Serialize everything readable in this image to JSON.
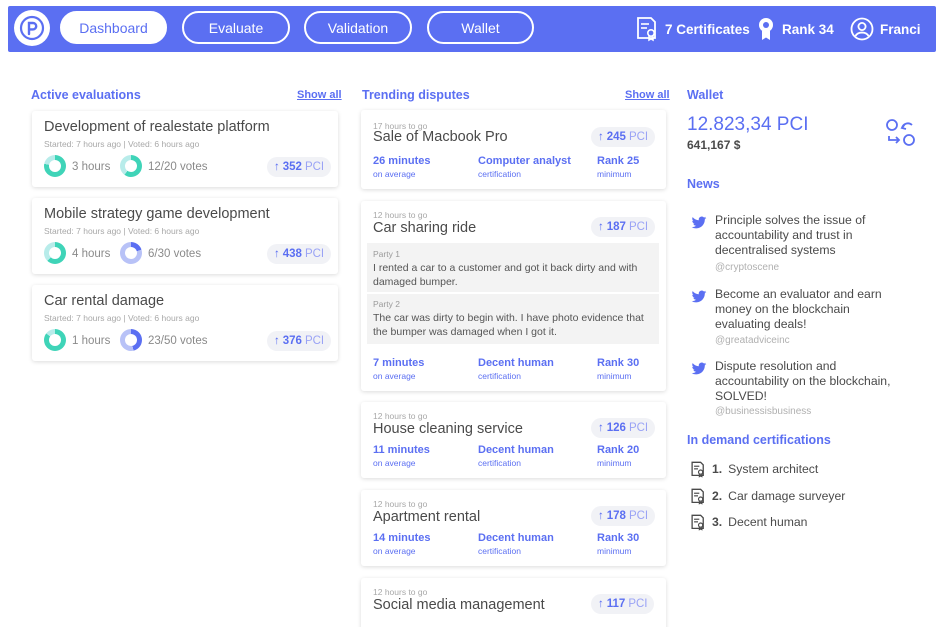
{
  "header": {
    "nav": [
      {
        "label": "Dashboard",
        "active": true
      },
      {
        "label": "Evaluate",
        "active": false
      },
      {
        "label": "Validation",
        "active": false
      },
      {
        "label": "Wallet",
        "active": false
      }
    ],
    "certificates_label": "7 Certificates",
    "rank_label": "Rank 34",
    "user_name": "Franci",
    "accent_color": "#5b6ff2"
  },
  "evaluations": {
    "title": "Active evaluations",
    "show_all": "Show all",
    "items": [
      {
        "title": "Development of realestate platform",
        "meta": "Started: 7 hours ago | Voted: 6 hours ago",
        "hours": "3 hours",
        "votes": "12/20 votes",
        "pci_value": "352",
        "pci_unit": "PCI"
      },
      {
        "title": "Mobile strategy game development",
        "meta": "Started: 7 hours ago | Voted: 6 hours ago",
        "hours": "4 hours",
        "votes": "6/30 votes",
        "pci_value": "438",
        "pci_unit": "PCI"
      },
      {
        "title": "Car rental damage",
        "meta": "Started: 7 hours ago | Voted: 6 hours ago",
        "hours": "1 hours",
        "votes": "23/50 votes",
        "pci_value": "376",
        "pci_unit": "PCI"
      }
    ]
  },
  "disputes": {
    "title": "Trending disputes",
    "show_all": "Show all",
    "items": [
      {
        "time": "17 hours to go",
        "title": "Sale of Macbook Pro",
        "pci_value": "245",
        "pci_unit": "PCI",
        "avg_value": "26 minutes",
        "avg_label": "on average",
        "cert_value": "Computer analyst",
        "cert_label": "certification",
        "rank_value": "Rank 25",
        "rank_label": "minimum"
      },
      {
        "time": "12 hours to go",
        "title": "Car sharing ride",
        "pci_value": "187",
        "pci_unit": "PCI",
        "party1_label": "Party 1",
        "party1_text": "I rented a car to a customer and got it back dirty and with damaged bumper.",
        "party2_label": "Party 2",
        "party2_text": "The car was dirty to begin with. I have photo evidence that the bumper was damaged when I got it.",
        "avg_value": "7 minutes",
        "avg_label": "on average",
        "cert_value": "Decent human",
        "cert_label": "certification",
        "rank_value": "Rank 30",
        "rank_label": "minimum"
      },
      {
        "time": "12 hours to go",
        "title": "House cleaning service",
        "pci_value": "126",
        "pci_unit": "PCI",
        "avg_value": "11 minutes",
        "avg_label": "on average",
        "cert_value": "Decent human",
        "cert_label": "certification",
        "rank_value": "Rank 20",
        "rank_label": "minimum"
      },
      {
        "time": "12 hours to go",
        "title": "Apartment rental",
        "pci_value": "178",
        "pci_unit": "PCI",
        "avg_value": "14 minutes",
        "avg_label": "on average",
        "cert_value": "Decent human",
        "cert_label": "certification",
        "rank_value": "Rank 30",
        "rank_label": "minimum"
      },
      {
        "time": "12 hours to go",
        "title": "Social media management",
        "pci_value": "117",
        "pci_unit": "PCI"
      }
    ]
  },
  "wallet": {
    "title": "Wallet",
    "amount": "12.823,34 PCI",
    "usd": "641,167 $"
  },
  "news": {
    "title": "News",
    "items": [
      {
        "text": "Principle solves the issue of accountability and trust in decentralised systems",
        "source": "@cryptoscene"
      },
      {
        "text": "Become an evaluator and earn money on the blockchain evaluating deals!",
        "source": "@greatadviceinc"
      },
      {
        "text": "Dispute resolution and accountability on the blockchain, SOLVED!",
        "source": "@businessisbusiness"
      }
    ]
  },
  "certifications": {
    "title": "In demand certifications",
    "items": [
      {
        "num": "1.",
        "name": "System architect"
      },
      {
        "num": "2.",
        "name": "Car damage surveyer"
      },
      {
        "num": "3.",
        "name": "Decent human"
      }
    ]
  }
}
